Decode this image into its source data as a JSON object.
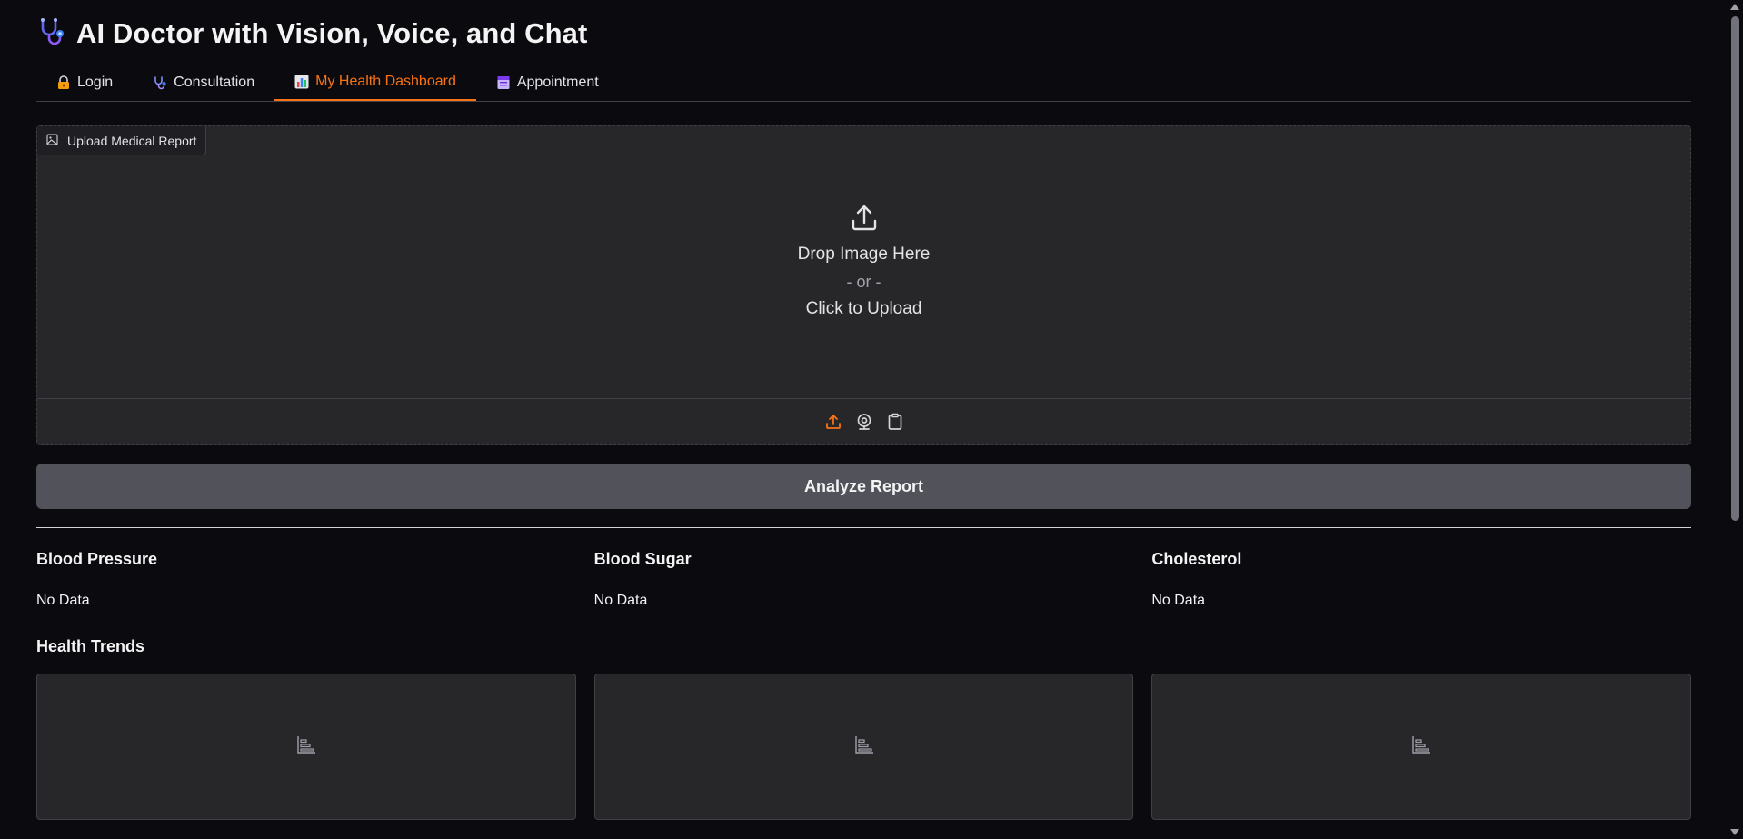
{
  "app": {
    "title": "AI Doctor with Vision, Voice, and Chat",
    "title_icon": "stethoscope-icon"
  },
  "tabs": [
    {
      "label": "Login",
      "icon": "lock-key-icon",
      "active": false
    },
    {
      "label": "Consultation",
      "icon": "stethoscope-icon",
      "active": false
    },
    {
      "label": "My Health Dashboard",
      "icon": "bar-chart-icon",
      "active": true
    },
    {
      "label": "Appointment",
      "icon": "calendar-icon",
      "active": false
    }
  ],
  "upload": {
    "label": "Upload Medical Report",
    "drop_text": "Drop Image Here",
    "or_text": "- or -",
    "click_text": "Click to Upload",
    "sources": [
      "upload-icon",
      "webcam-icon",
      "clipboard-icon"
    ]
  },
  "analyze_button": "Analyze Report",
  "metrics": [
    {
      "title": "Blood Pressure",
      "value": "No Data"
    },
    {
      "title": "Blood Sugar",
      "value": "No Data"
    },
    {
      "title": "Cholesterol",
      "value": "No Data"
    }
  ],
  "trends": {
    "title": "Health Trends",
    "plots": [
      "empty-plot-icon",
      "empty-plot-icon",
      "empty-plot-icon"
    ]
  },
  "colors": {
    "accent": "#f97316",
    "background": "#0b0b0f",
    "panel": "#27272a",
    "button": "#52525b"
  }
}
